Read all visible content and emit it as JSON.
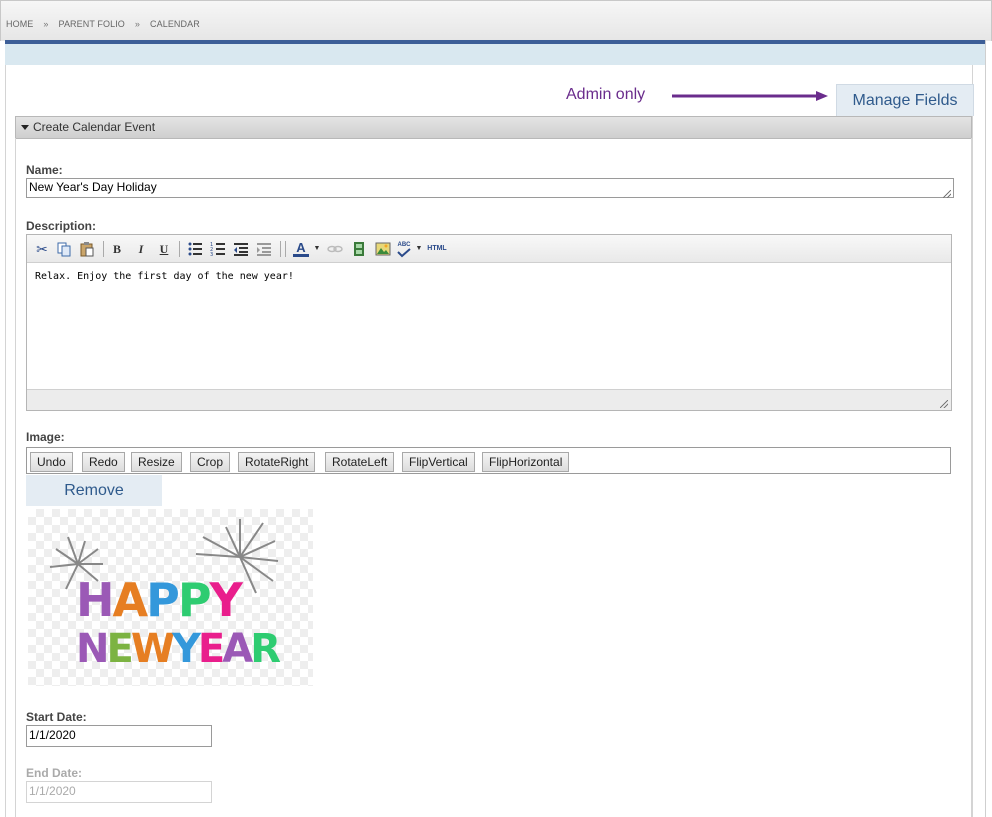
{
  "breadcrumb": {
    "items": [
      "HOME",
      "PARENT FOLIO",
      "CALENDAR"
    ],
    "separator": "»"
  },
  "annotation": {
    "text": "Admin only",
    "color": "#6a2c8c"
  },
  "manage_fields": {
    "label": "Manage Fields"
  },
  "section": {
    "title": "Create Calendar Event"
  },
  "form": {
    "name": {
      "label": "Name:",
      "value": "New Year's Day Holiday"
    },
    "description": {
      "label": "Description:",
      "content": "Relax. Enjoy the first day of the new year!",
      "toolbar": {
        "cut_icon": "✂",
        "bold_label": "B",
        "italic_label": "I",
        "underline_label": "U",
        "font_color_label": "A",
        "spellcheck_label": "ABC",
        "html_label": "HTML"
      }
    },
    "image": {
      "label": "Image:",
      "tools": [
        "Undo",
        "Redo",
        "Resize",
        "Crop",
        "RotateRight",
        "RotateLeft",
        "FlipVertical",
        "FlipHorizontal"
      ],
      "remove_label": "Remove",
      "preview": {
        "line1": [
          "H",
          "A",
          "P",
          "P",
          "Y"
        ],
        "line2": [
          "N",
          "E",
          "W",
          "Y",
          "E",
          "A",
          "R"
        ]
      }
    },
    "start_date": {
      "label": "Start Date:",
      "value": "1/1/2020"
    },
    "end_date": {
      "label": "End Date:",
      "value": "1/1/2020"
    }
  },
  "colors": {
    "accent": "#3c5e97",
    "button_bg": "#e4ecf3",
    "button_text": "#2f5a8c",
    "happy_colors": [
      "#9b59b6",
      "#e67e22",
      "#3498db",
      "#2ecc71",
      "#e91e8c"
    ],
    "newyear_colors": [
      "#9b59b6",
      "#7cb342",
      "#e67e22",
      "#3498db",
      "#e91e8c",
      "#9b59b6",
      "#2ecc71"
    ]
  }
}
